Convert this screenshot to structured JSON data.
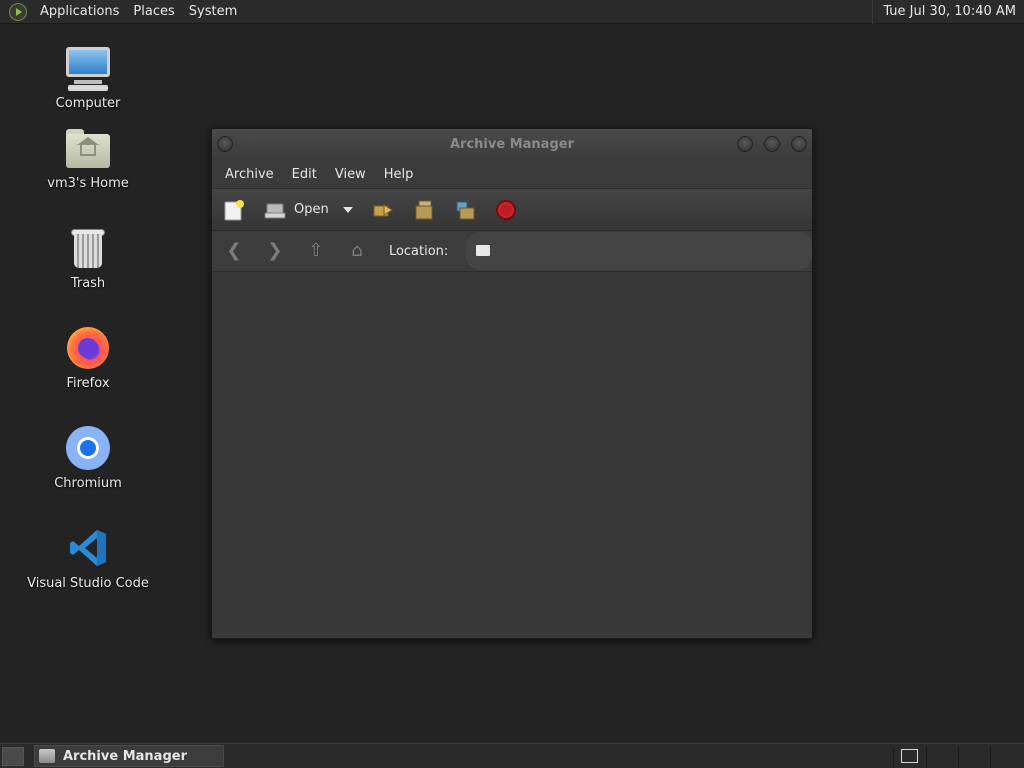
{
  "top_panel": {
    "menus": [
      "Applications",
      "Places",
      "System"
    ],
    "clock": "Tue Jul 30, 10:40 AM"
  },
  "desktop": {
    "icons": [
      {
        "label": "Computer",
        "icon": "computer-icon"
      },
      {
        "label": "vm3's Home",
        "icon": "home-folder-icon"
      },
      {
        "label": "Trash",
        "icon": "trash-icon"
      },
      {
        "label": "Firefox",
        "icon": "firefox-icon"
      },
      {
        "label": "Chromium",
        "icon": "chromium-icon"
      },
      {
        "label": "Visual Studio Code",
        "icon": "vscode-icon"
      }
    ]
  },
  "window": {
    "title": "Archive Manager",
    "menu": [
      "Archive",
      "Edit",
      "View",
      "Help"
    ],
    "toolbar": {
      "new_icon": "new-archive-icon",
      "open_label": "Open",
      "extract_icon": "extract-icon",
      "add_files_icon": "add-files-icon",
      "add_folder_icon": "add-folder-icon",
      "stop_icon": "stop-icon"
    },
    "location": {
      "label": "Location:",
      "value": ""
    }
  },
  "taskbar": {
    "task_label": "Archive Manager"
  },
  "colors": {
    "desktop_bg": "#232323",
    "panel_bg": "#2b2b2b",
    "window_bg": "#3a3a3a",
    "stop_red": "#d0222a"
  }
}
